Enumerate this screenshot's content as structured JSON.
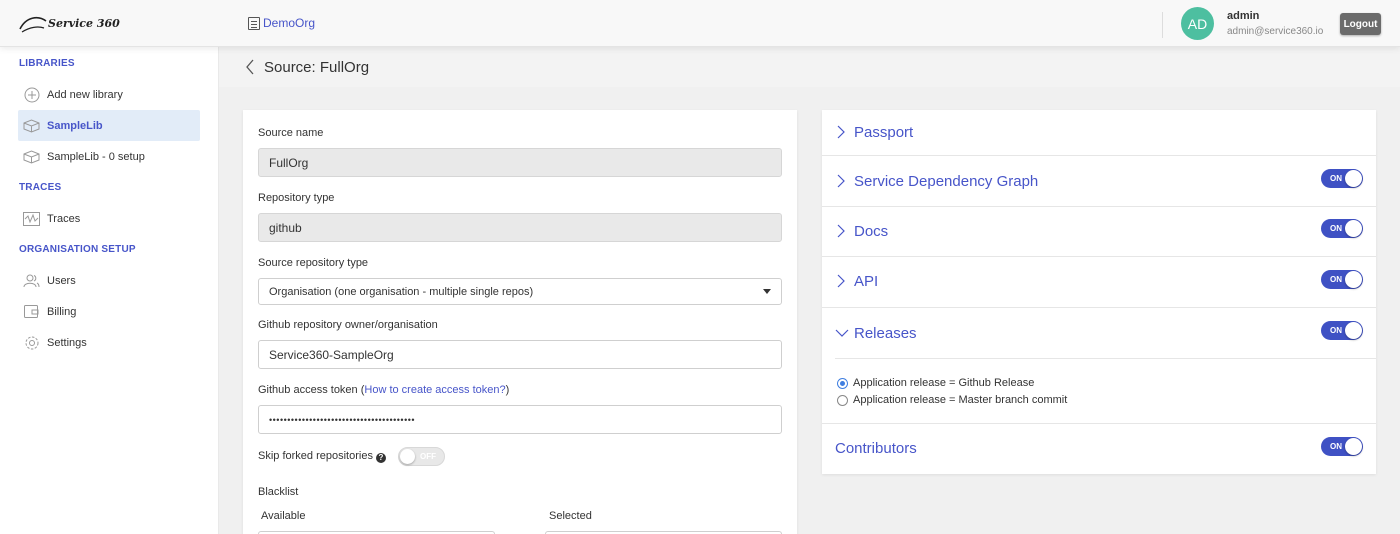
{
  "topbar": {
    "logo_text": "Service 360",
    "org_name": "DemoOrg",
    "avatar_initials": "AD",
    "user_name": "admin",
    "user_email": "admin@service360.io",
    "logout_label": "Logout"
  },
  "sidebar": {
    "libraries_title": "LIBRARIES",
    "library_items": [
      {
        "label": "Add new library",
        "icon": "plus-circle-icon"
      },
      {
        "label": "SampleLib",
        "icon": "box-icon",
        "active": true
      },
      {
        "label": "SampleLib - 0 setup",
        "icon": "box-icon"
      }
    ],
    "traces_title": "TRACES",
    "traces_items": [
      {
        "label": "Traces",
        "icon": "waveform-icon"
      }
    ],
    "org_title": "ORGANISATION SETUP",
    "org_items": [
      {
        "label": "Users",
        "icon": "users-icon"
      },
      {
        "label": "Billing",
        "icon": "wallet-icon"
      },
      {
        "label": "Settings",
        "icon": "gear-icon"
      }
    ]
  },
  "page": {
    "title": "Source: FullOrg"
  },
  "form": {
    "source_name_label": "Source name",
    "source_name_value": "FullOrg",
    "repo_type_label": "Repository type",
    "repo_type_value": "github",
    "source_repo_type_label": "Source repository type",
    "source_repo_type_value": "Organisation (one organisation - multiple single repos)",
    "owner_label": "Github repository owner/organisation",
    "owner_value": "Service360-SampleOrg",
    "token_label_prefix": "Github access token (",
    "token_link": "How to create access token?",
    "token_label_suffix": ")",
    "token_value": "••••••••••••••••••••••••••••••••••••••••",
    "skip_forked_label": "Skip forked repositories",
    "skip_forked_toggle": "OFF",
    "blacklist_label": "Blacklist",
    "available_label": "Available",
    "selected_label": "Selected"
  },
  "right_panel": {
    "passport": "Passport",
    "service_graph": "Service Dependency Graph",
    "docs": "Docs",
    "api": "API",
    "releases": "Releases",
    "release_option_1": "Application release = Github Release",
    "release_option_2": "Application release = Master branch commit",
    "contributors": "Contributors",
    "toggle_on_label": "ON"
  },
  "colors": {
    "accent": "#4755c9",
    "toggle_on": "#3f51c4",
    "avatar": "#4dbfa0",
    "active_nav_bg": "#e2ecf8"
  }
}
